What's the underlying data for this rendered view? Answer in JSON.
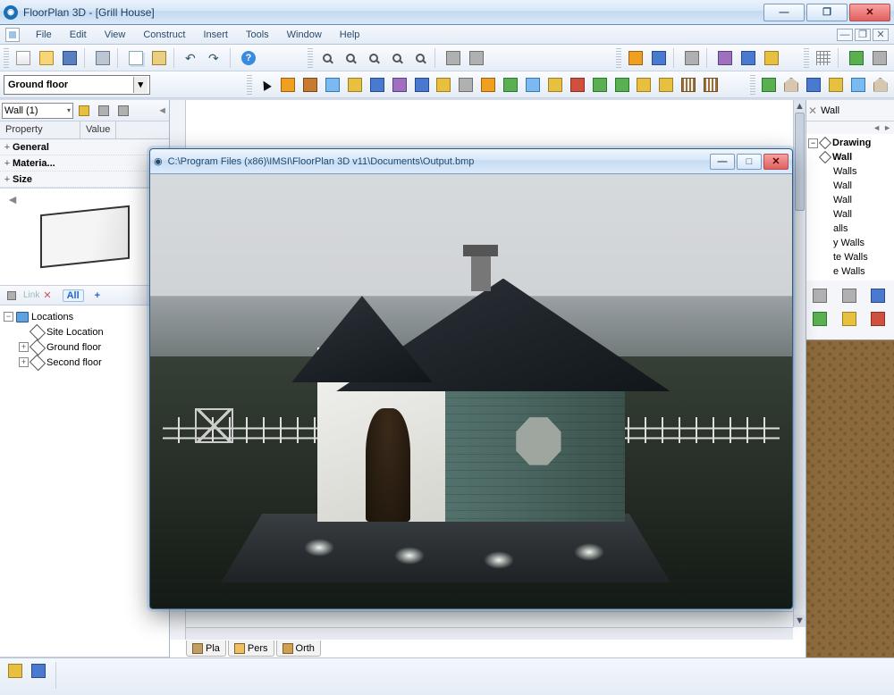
{
  "app": {
    "title": "FloorPlan 3D - [Grill House]"
  },
  "menu": {
    "file": "File",
    "edit": "Edit",
    "view": "View",
    "construct": "Construct",
    "insert": "Insert",
    "tools": "Tools",
    "window": "Window",
    "help": "Help"
  },
  "floor_selector": {
    "value": "Ground floor"
  },
  "left": {
    "element_combo": "Wall (1)",
    "columns": {
      "property": "Property",
      "value": "Value"
    },
    "groups": {
      "general": "General",
      "material": "Materia...",
      "size": "Size"
    },
    "sel_toolbar": {
      "link": "Link",
      "all": "All"
    },
    "tree": {
      "root": "Locations",
      "site": "Site Location",
      "ground": "Ground floor",
      "second": "Second floor"
    }
  },
  "right": {
    "header": "Wall",
    "drawing": "Drawing",
    "wall": "Wall",
    "partial_items": [
      "Walls",
      "Wall",
      "Wall",
      "Wall",
      "alls",
      "y Walls",
      "te Walls",
      "e Walls"
    ]
  },
  "view_tabs": {
    "plan": "Pla",
    "perspective": "Pers",
    "ortho": "Orth"
  },
  "popup": {
    "title": "C:\\Program Files (x86)\\IMSI\\FloorPlan 3D v11\\Documents\\Output.bmp"
  },
  "glyphs": {
    "minimize": "—",
    "maximize": "□",
    "restore": "❐",
    "close": "✕",
    "dropdown": "▾",
    "expand": "+",
    "collapse": "−",
    "left": "◄",
    "right": "►",
    "up": "▲",
    "down": "▼",
    "help": "?",
    "plus": "+",
    "cross": "✕"
  }
}
